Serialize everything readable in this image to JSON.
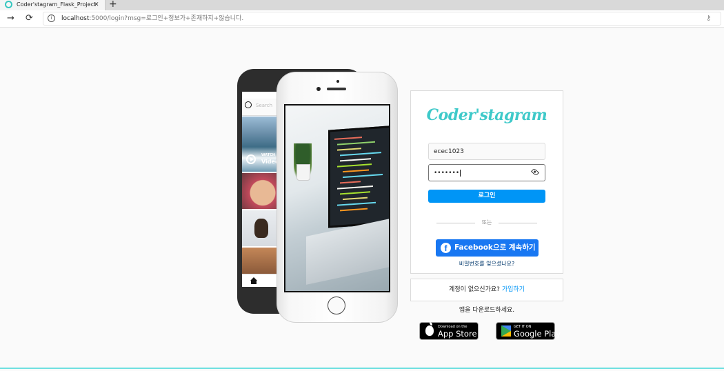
{
  "browser": {
    "tab_title": "Coder'stagram_Flask_Project",
    "tab_close": "✕",
    "new_tab": "+",
    "back": "→",
    "reload": "⟳",
    "url_host": "localhost",
    "url_rest": ":5000/login?msg=로그인+정보가+존재하지+않습니다.",
    "key_glyph": "⚷"
  },
  "phones": {
    "search_placeholder": "Search",
    "watch_label": "WATCH",
    "video_label": "Video"
  },
  "login": {
    "logo": "Coder'stagram",
    "username_value": "ecec1023",
    "password_value": "•••••••",
    "login_button": "로그인",
    "or_text": "또는",
    "facebook_icon_letter": "f",
    "facebook_button": "Facebook으로 계속하기",
    "forgot_password": "비밀번호를 잊으셨나요?"
  },
  "signup": {
    "prompt": "계정이 없으신가요?",
    "link": "가입하기"
  },
  "download": {
    "text": "앱을 다운로드하세요.",
    "app_store_small": "Download on the",
    "app_store_big": "App Store",
    "google_play_small": "GET IT ON",
    "google_play_big": "Google Play"
  },
  "colors": {
    "brand_teal": "#3ec9c9",
    "primary_blue": "#0095f6",
    "facebook_blue": "#1877f2"
  }
}
